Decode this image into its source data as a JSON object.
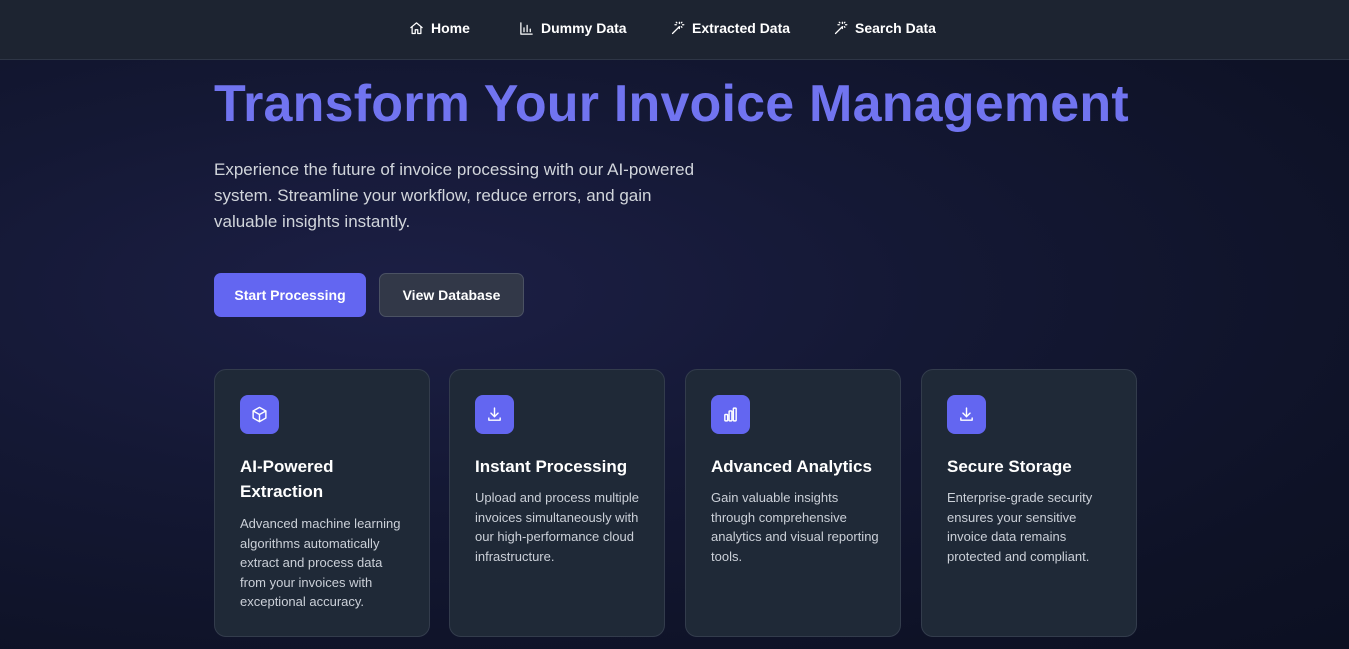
{
  "nav": {
    "items": [
      {
        "label": "Home",
        "icon": "home-icon"
      },
      {
        "label": "Dummy Data",
        "icon": "bar-chart-icon"
      },
      {
        "label": "Extracted Data",
        "icon": "magic-wand-icon"
      },
      {
        "label": "Search Data",
        "icon": "magic-wand-icon"
      }
    ]
  },
  "hero": {
    "title": "Transform Your Invoice Management",
    "subtitle": "Experience the future of invoice processing with our AI-powered system. Streamline your workflow, reduce errors, and gain valuable insights instantly.",
    "primary_button": "Start Processing",
    "secondary_button": "View Database"
  },
  "features": [
    {
      "icon": "cube-icon",
      "title": "AI-Powered Extraction",
      "description": "Advanced machine learning algorithms automatically extract and process data from your invoices with exceptional accuracy."
    },
    {
      "icon": "download-icon",
      "title": "Instant Processing",
      "description": "Upload and process multiple invoices simultaneously with our high-performance cloud infrastructure."
    },
    {
      "icon": "bar-chart-icon",
      "title": "Advanced Analytics",
      "description": "Gain valuable insights through comprehensive analytics and visual reporting tools."
    },
    {
      "icon": "download-icon",
      "title": "Secure Storage",
      "description": "Enterprise-grade security ensures your sensitive invoice data remains protected and compliant."
    }
  ],
  "colors": {
    "accent": "#6366f1",
    "title": "#7174f0",
    "navbar": "#1d2431",
    "card": "#1f2937"
  }
}
